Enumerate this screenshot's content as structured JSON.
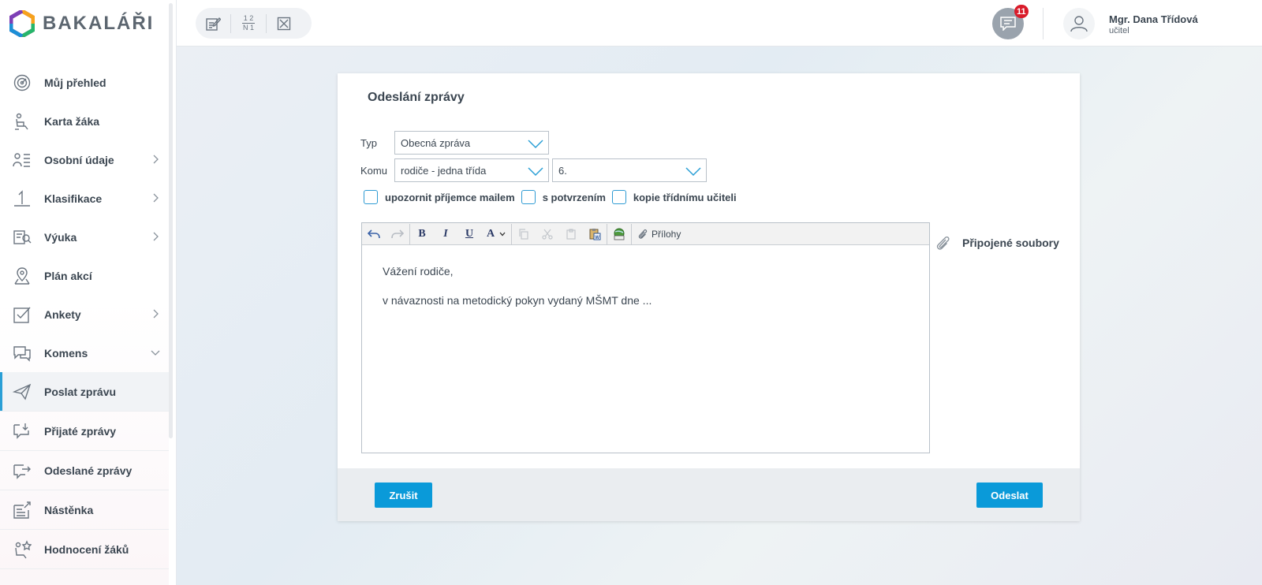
{
  "app": {
    "logo_text": "BAKALÁŘI"
  },
  "sidebar": {
    "items": [
      {
        "label": "Můj přehled",
        "icon": "dashboard-icon",
        "chevron": ""
      },
      {
        "label": "Karta žáka",
        "icon": "student-card-icon",
        "chevron": ""
      },
      {
        "label": "Osobní údaje",
        "icon": "personal-data-icon",
        "chevron": "right"
      },
      {
        "label": "Klasifikace",
        "icon": "grade-icon",
        "chevron": "right"
      },
      {
        "label": "Výuka",
        "icon": "teaching-icon",
        "chevron": "right"
      },
      {
        "label": "Plán akcí",
        "icon": "map-pin-icon",
        "chevron": ""
      },
      {
        "label": "Ankety",
        "icon": "checkbox-icon",
        "chevron": "right"
      },
      {
        "label": "Komens",
        "icon": "chat-icon",
        "chevron": "down"
      }
    ],
    "sub_items": [
      {
        "label": "Poslat zprávu",
        "icon": "send-icon",
        "active": true
      },
      {
        "label": "Přijaté zprávy",
        "icon": "inbox-icon",
        "active": false
      },
      {
        "label": "Odeslané zprávy",
        "icon": "sent-icon",
        "active": false
      },
      {
        "label": "Nástěnka",
        "icon": "board-icon",
        "active": false
      },
      {
        "label": "Hodnocení žáků",
        "icon": "star-student-icon",
        "active": false
      }
    ]
  },
  "header": {
    "tools": [
      "edit-icon",
      "numbers-icon",
      "close-box-icon"
    ],
    "tool_numbers": {
      "top": "1 2",
      "bottom": "N 1"
    },
    "messages_badge": "11",
    "user": {
      "name": "Mgr. Dana Třídová",
      "role": "učitel"
    }
  },
  "form": {
    "title": "Odeslání zprávy",
    "type_label": "Typ",
    "type_value": "Obecná zpráva",
    "to_label": "Komu",
    "to_value": "rodiče - jedna třída",
    "class_value": "6.",
    "checkboxes": [
      "upozornit příjemce mailem",
      "s potvrzením",
      "kopie třídnímu učiteli"
    ],
    "attachments_button": "Přílohy",
    "attached_files_label": "Připojené soubory",
    "body_lines": [
      "Vážení  rodiče,",
      "v návaznosti na metodický pokyn vydaný MŠMT dne ..."
    ],
    "cancel_label": "Zrušit",
    "send_label": "Odeslat"
  },
  "colors": {
    "accent": "#0a9ad9",
    "badge": "#d91b2a",
    "active_bar": "#2a9fd6"
  }
}
